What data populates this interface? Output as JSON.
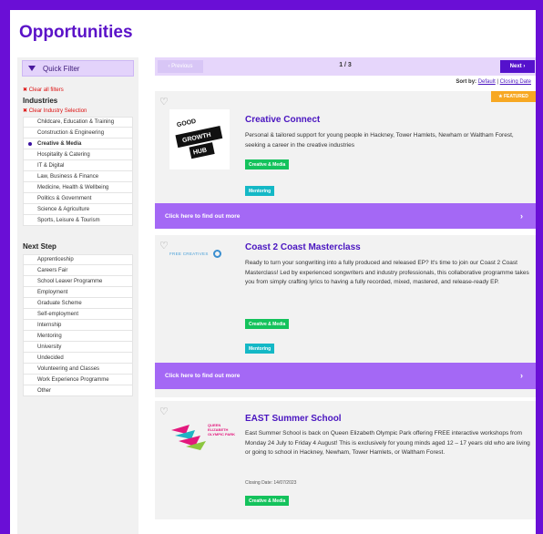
{
  "page": {
    "title": "Opportunities"
  },
  "sidebar": {
    "quick_filter_label": "Quick Filter",
    "clear_all": "✖ Clear all filters",
    "industries_heading": "Industries",
    "clear_industry": "✖ Clear Industry Selection",
    "industries": [
      "Childcare, Education & Training",
      "Construction & Engineering",
      "Creative & Media",
      "Hospitality & Catering",
      "IT & Digital",
      "Law, Business & Finance",
      "Medicine, Health & Wellbeing",
      "Politics & Government",
      "Science & Agriculture",
      "Sports, Leisure & Tourism"
    ],
    "selected_industry": "Creative & Media",
    "next_step_heading": "Next Step",
    "next_steps": [
      "Apprenticeship",
      "Careers Fair",
      "School Leaver Programme",
      "Employment",
      "Graduate Scheme",
      "Self-employment",
      "Internship",
      "Mentoring",
      "University",
      "Undecided",
      "Volunteering and Classes",
      "Work Experience Programme",
      "Other"
    ]
  },
  "pager": {
    "previous_label": "‹ Previous",
    "page_count": "1 / 3",
    "next_label": "Next ›"
  },
  "sort": {
    "label": "Sort by:",
    "default": "Default",
    "separator": "|",
    "closing_date": "Closing Date"
  },
  "cards": [
    {
      "title": "Creative Connect",
      "description": "Personal & tailored support for young people in Hackney, Tower Hamlets, Newham or Waltham Forest, seeking a career in the creative industries",
      "tags": [
        "Creative & Media",
        "Mentoring"
      ],
      "featured": "★ FEATURED",
      "logo_text": [
        "GOOD",
        "GROWTH",
        "HUB"
      ],
      "cta": "Click here to find out more"
    },
    {
      "title": "Coast 2 Coast Masterclass",
      "description": "Ready to turn your songwriting into a fully produced and released EP? It's time to join our Coast 2 Coast Masterclass! Led by experienced songwriters and industry professionals, this collaborative programme takes you from simply crafting lyrics to having a fully recorded, mixed, mastered, and release-ready EP.",
      "tags": [
        "Creative & Media",
        "Mentoring"
      ],
      "logo_text": "FREE CREATIVES",
      "cta": "Click here to find out more"
    },
    {
      "title": "EAST Summer School",
      "description": "East Summer School is back on Queen Elizabeth Olympic Park offering FREE interactive workshops from Monday 24 July to Friday 4 August! This is exclusively for young minds aged 12 – 17 years old who are living or going to school in Hackney, Newham, Tower Hamlets, or Waltham Forest.",
      "closing_date": "Closing Date: 14/07/2023",
      "tags": [
        "Creative & Media"
      ],
      "logo_text": [
        "QUEEN",
        "ELIZABETH",
        "OLYMPIC PARK"
      ]
    }
  ],
  "colors": {
    "brand_purple": "#5b12c8",
    "cta_purple": "#a468f5",
    "featured_orange": "#f7a823",
    "tag_green": "#14c25c",
    "tag_teal": "#14b8c6"
  }
}
